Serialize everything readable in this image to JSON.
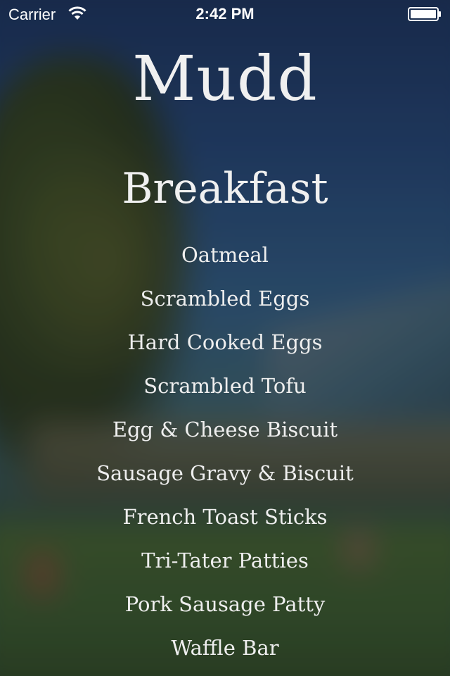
{
  "status_bar": {
    "carrier": "Carrier",
    "time": "2:42 PM",
    "wifi_icon": "wifi-icon",
    "battery_icon": "battery-icon"
  },
  "header": {
    "location": "Mudd"
  },
  "meal": {
    "name": "Breakfast",
    "items": [
      "Oatmeal",
      "Scrambled Eggs",
      "Hard Cooked Eggs",
      "Scrambled Tofu",
      "Egg & Cheese Biscuit",
      "Sausage Gravy & Biscuit",
      "French Toast Sticks",
      "Tri-Tater Patties",
      "Pork Sausage Patty",
      "Waffle Bar"
    ]
  },
  "colors": {
    "text": "#f0f0f0",
    "background_tint": "#24324a"
  }
}
